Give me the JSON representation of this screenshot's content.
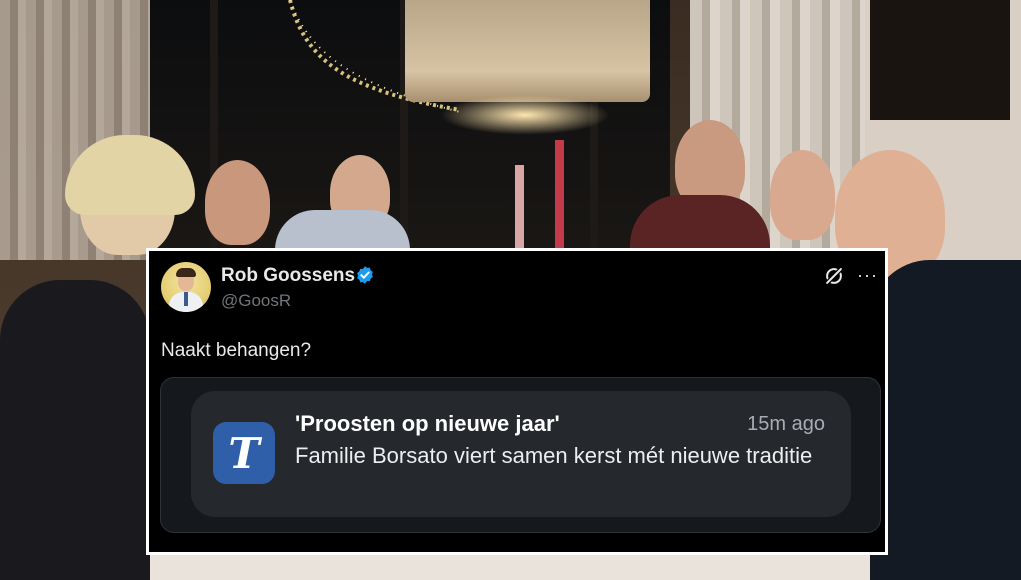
{
  "tweet": {
    "author_name": "Rob Goossens",
    "author_handle": "@GoosR",
    "verified": true,
    "text": "Naakt behangen?",
    "icons": {
      "verified": "verified-badge-icon",
      "grok": "grok-icon",
      "more": "more-options-icon"
    },
    "more_glyph": "···"
  },
  "notification": {
    "app_icon": "de-telegraaf-app-icon",
    "app_icon_letter": "T",
    "title": "'Proosten op nieuwe jaar'",
    "time": "15m ago",
    "body": "Familie Borsato viert samen kerst mét nieuwe traditie"
  },
  "colors": {
    "tweet_background": "#000000",
    "verified_blue": "#1d9bf0",
    "notification_background": "#25282c",
    "app_icon_blue": "#2e5fa8"
  }
}
